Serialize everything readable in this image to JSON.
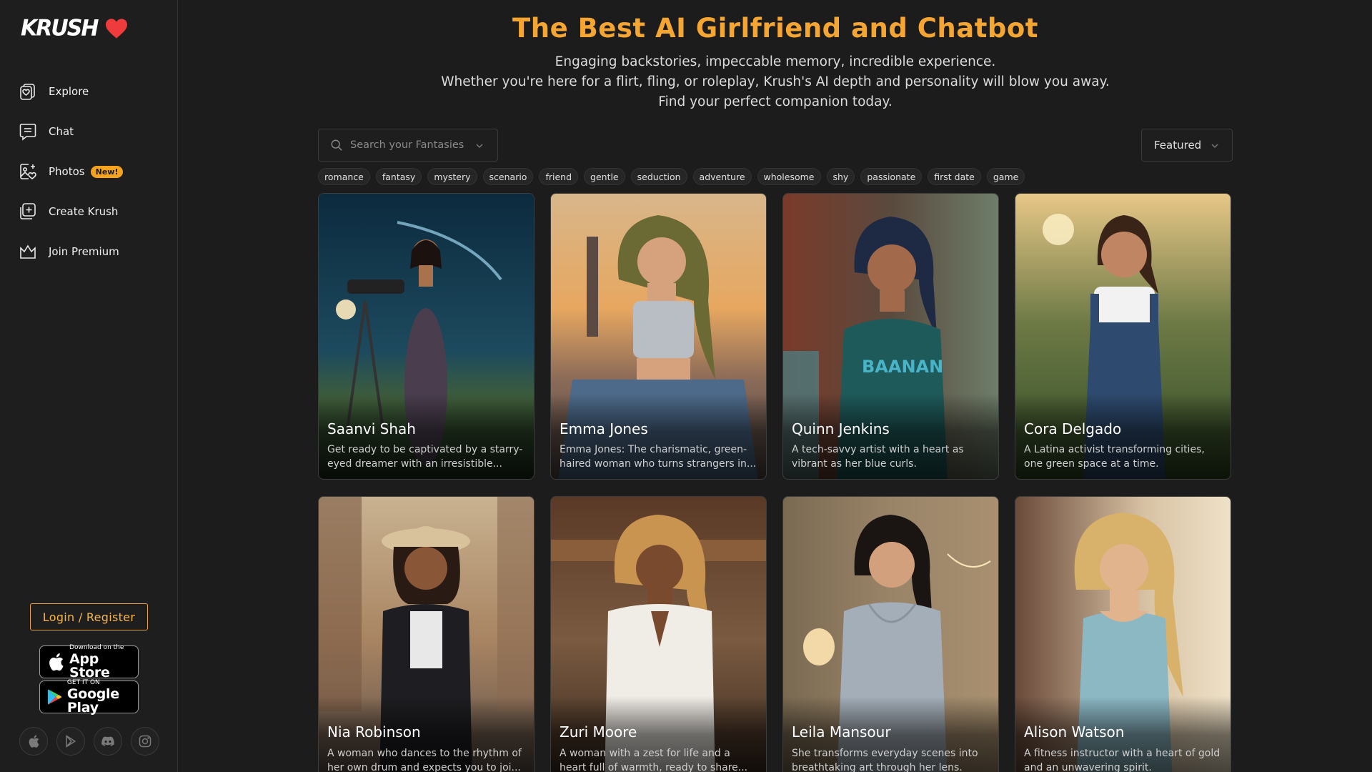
{
  "brand": {
    "name": "KRUSH",
    "heart_color": "#ef3b3b"
  },
  "sidebar": {
    "items": [
      {
        "label": "Explore",
        "icon": "explore-icon"
      },
      {
        "label": "Chat",
        "icon": "chat-icon"
      },
      {
        "label": "Photos",
        "icon": "photos-icon",
        "badge": "New!"
      },
      {
        "label": "Create Krush",
        "icon": "create-icon"
      },
      {
        "label": "Join Premium",
        "icon": "crown-icon"
      }
    ],
    "login_label": "Login / Register",
    "app_store": {
      "small": "Download on the",
      "big": "App Store"
    },
    "google_play": {
      "small": "GET IT ON",
      "big": "Google Play"
    },
    "socials": [
      "apple-icon",
      "play-icon",
      "discord-icon",
      "instagram-icon"
    ]
  },
  "hero": {
    "title": "The Best AI Girlfriend and Chatbot",
    "line1": "Engaging backstories, impeccable memory, incredible experience.",
    "line2": "Whether you're here for a flirt, fling, or roleplay, Krush's AI depth and personality will blow you away.",
    "line3": "Find your perfect companion today."
  },
  "search": {
    "placeholder": "Search your Fantasies"
  },
  "sort": {
    "selected": "Featured"
  },
  "tags": [
    "romance",
    "fantasy",
    "mystery",
    "scenario",
    "friend",
    "gentle",
    "seduction",
    "adventure",
    "wholesome",
    "shy",
    "passionate",
    "first date",
    "game"
  ],
  "cards": [
    {
      "name": "Saanvi Shah",
      "desc": "Get ready to be captivated by a starry-eyed dreamer with an irresistible..."
    },
    {
      "name": "Emma Jones",
      "desc": "Emma Jones: The charismatic, green-haired woman who turns strangers in..."
    },
    {
      "name": "Quinn Jenkins",
      "desc": "A tech-savvy artist with a heart as vibrant as her blue curls."
    },
    {
      "name": "Cora Delgado",
      "desc": "A Latina activist transforming cities, one green space at a time."
    },
    {
      "name": "Nia Robinson",
      "desc": "A woman who dances to the rhythm of her own drum and expects you to joi..."
    },
    {
      "name": "Zuri Moore",
      "desc": "A woman with a zest for life and a heart full of warmth, ready to share..."
    },
    {
      "name": "Leila Mansour",
      "desc": "She transforms everyday scenes into breathtaking art through her lens."
    },
    {
      "name": "Alison Watson",
      "desc": "A fitness instructor with a heart of gold and an unwavering spirit."
    }
  ],
  "colors": {
    "accent": "#f5a531",
    "background": "#1c1c1c"
  }
}
